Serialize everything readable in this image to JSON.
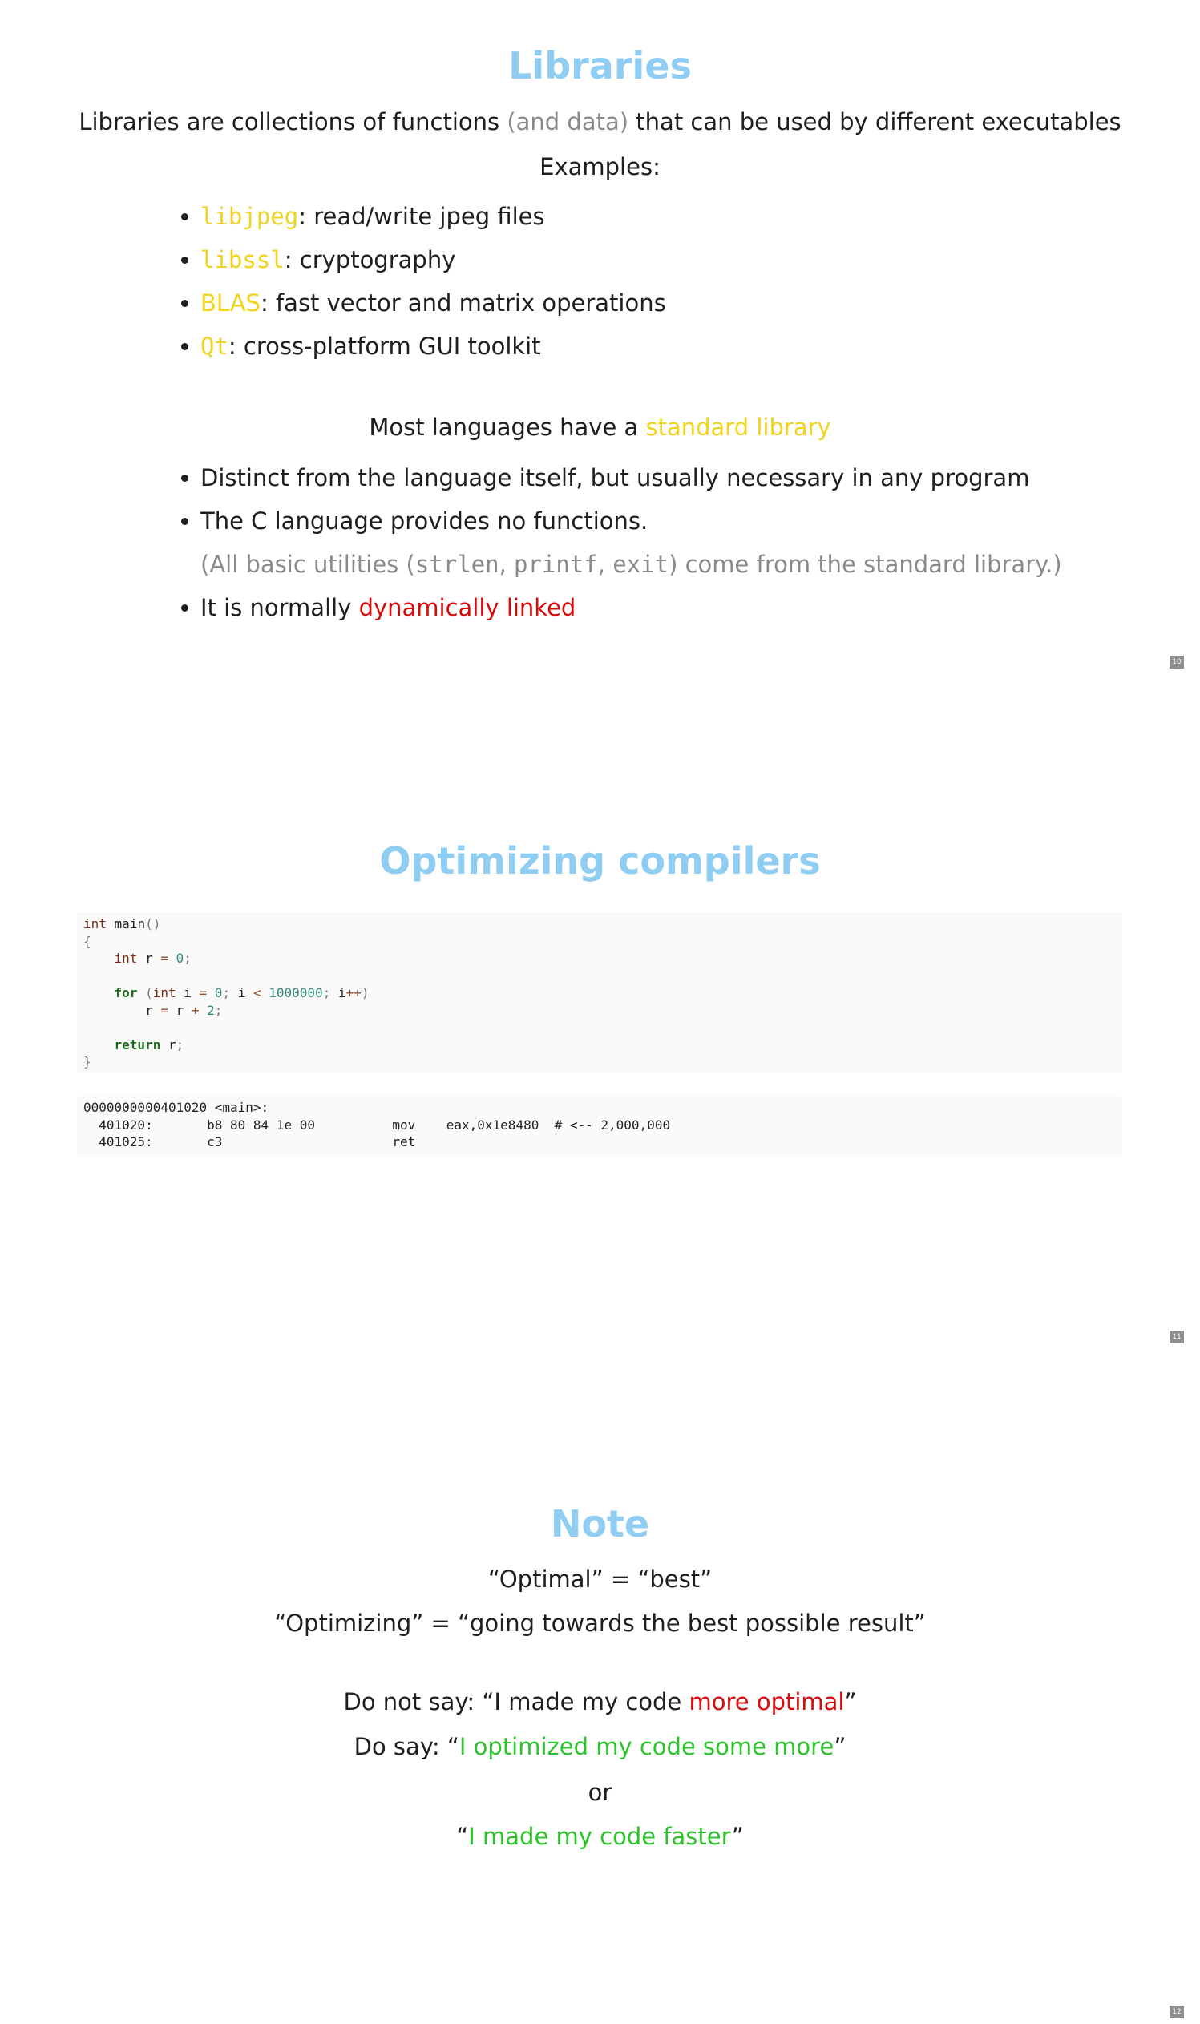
{
  "slide1": {
    "title": "Libraries",
    "intro": {
      "before": "Libraries are collections of functions ",
      "muted": "(and data)",
      "after": " that can be used by different executables"
    },
    "examples_label": "Examples:",
    "examples": [
      {
        "name": "libjpeg",
        "desc": ": read/write jpeg files"
      },
      {
        "name": "libssl",
        "desc": ": cryptography"
      },
      {
        "name": "BLAS",
        "desc": ": fast vector and matrix operations"
      },
      {
        "name": "Qt",
        "desc": ": cross-platform GUI toolkit"
      }
    ],
    "stdlib_line": {
      "before": "Most languages have a ",
      "highlight": "standard library"
    },
    "points": {
      "p1": "Distinct from the language itself, but usually necessary in any program",
      "p2": "The C language provides no functions.",
      "note_open": "(All basic utilities (",
      "fn1": "strlen",
      "sep1": ", ",
      "fn2": "printf",
      "sep2": ", ",
      "fn3": "exit",
      "note_close": ") come from the standard library.)",
      "p3_before": "It is normally ",
      "p3_highlight": "dynamically linked"
    },
    "page_number": "10"
  },
  "slide2": {
    "title": "Optimizing compilers",
    "source": {
      "l1_type": "int",
      "l1_rest": " main",
      "l1_paren": "()",
      "l2": "{",
      "l3_type": "int",
      "l3_a": " r ",
      "l3_eq": "=",
      "l3_num": "0",
      "l3_semi": ";",
      "l5_for": "for",
      "l5_open": " (",
      "l5_type": "int",
      "l5_a": " i ",
      "l5_eq": "=",
      "l5_num0": "0",
      "l5_semi1": ";",
      "l5_b": " i ",
      "l5_lt": "<",
      "l5_num1": "1000000",
      "l5_semi2": ";",
      "l5_c": " i",
      "l5_inc": "++",
      "l5_close": ")",
      "l6_a": "r ",
      "l6_eq": "=",
      "l6_b": " r ",
      "l6_plus": "+",
      "l6_num": "2",
      "l6_semi": ";",
      "l8_ret": "return",
      "l8_rest": " r",
      "l8_semi": ";",
      "l9": "}"
    },
    "disasm": [
      "0000000000401020 <main>:",
      "  401020:\tb8 80 84 1e 00       \tmov    eax,0x1e8480  # <-- 2,000,000",
      "  401025:\tc3                   \tret"
    ],
    "page_number": "11"
  },
  "slide3": {
    "title": "Note",
    "line1": "“Optimal” = “best”",
    "line2": "“Optimizing” = “going towards the best possible result”",
    "dont": {
      "before": "Do not say: “I made my code ",
      "highlight": "more optimal",
      "after": "”"
    },
    "do": {
      "before": "Do say: “",
      "highlight": "I optimized my code some more",
      "after": "”"
    },
    "or": "or",
    "alt": {
      "before": "“",
      "highlight": "I made my code faster",
      "after": "”"
    },
    "page_number": "12"
  }
}
